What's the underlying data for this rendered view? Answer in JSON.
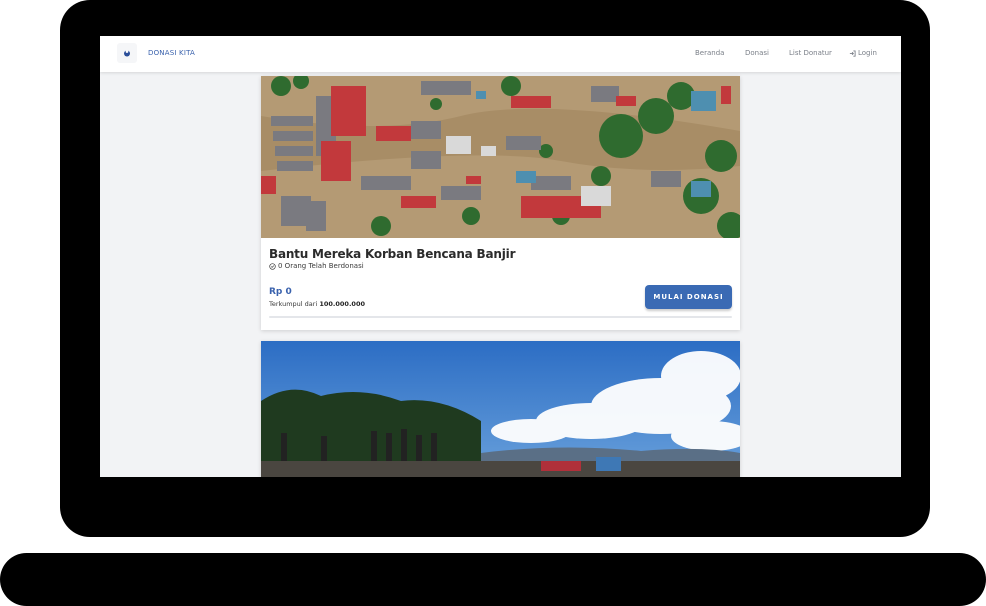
{
  "navbar": {
    "brand": "DONASI KITA",
    "links": [
      "Beranda",
      "Donasi",
      "List Donatur",
      "Login"
    ]
  },
  "campaigns": [
    {
      "title": "Bantu Mereka Korban Bencana Banjir",
      "donors_text": "0 Orang Telah Berdonasi",
      "amount": "Rp 0",
      "collected_prefix": "Terkumpul dari",
      "target": "100.000.000",
      "cta": "MULAI DONASI",
      "progress": 0
    }
  ],
  "colors": {
    "accent": "#3a62ad",
    "button": "#3a6ab4"
  },
  "icons": [
    "logo-icon",
    "check-circle-icon",
    "login-icon"
  ]
}
